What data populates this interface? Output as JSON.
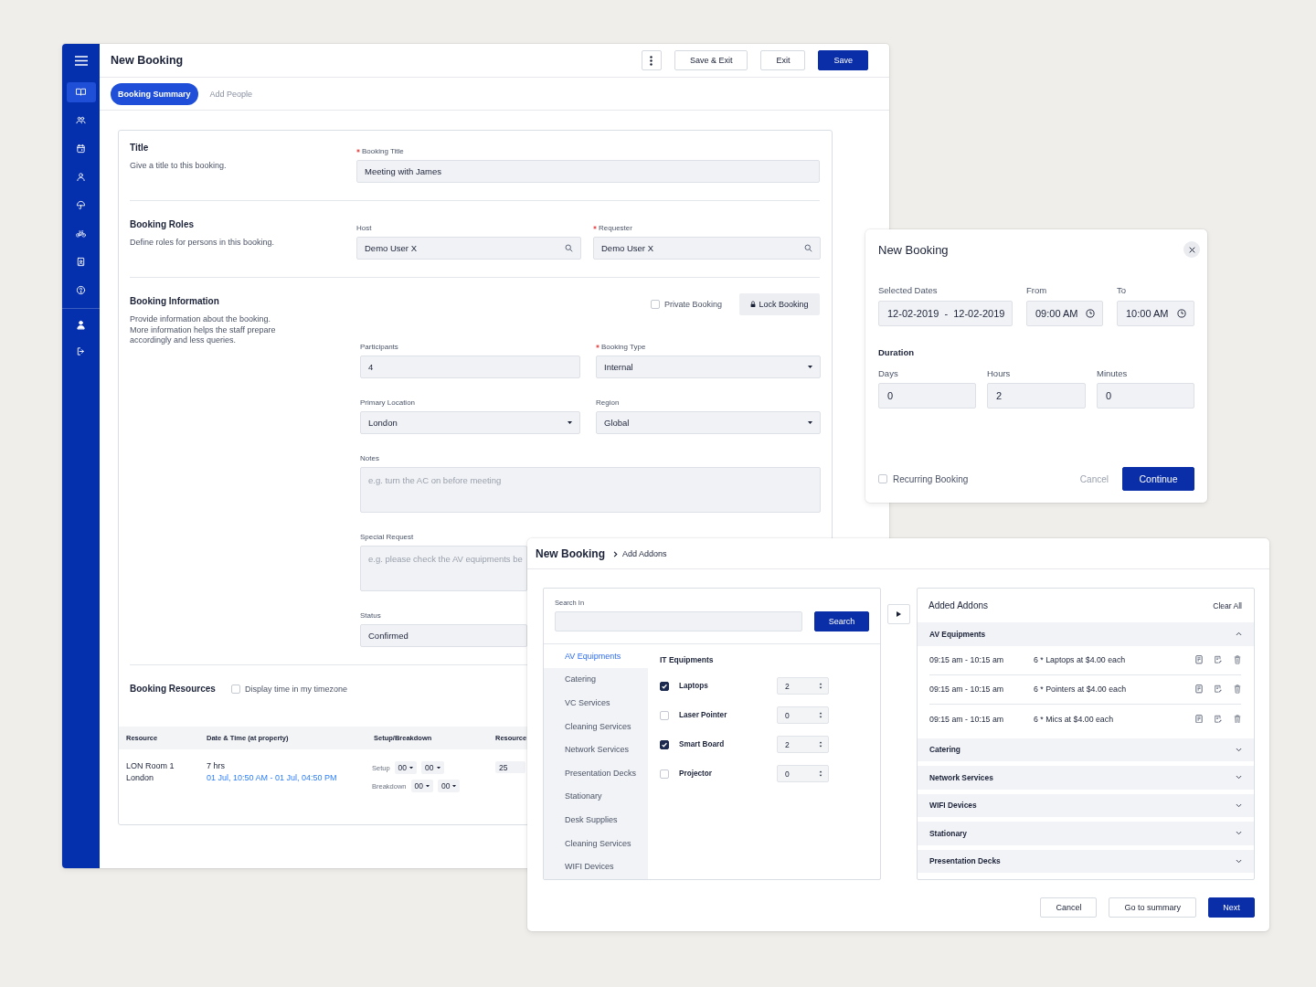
{
  "main_window": {
    "sidebar": {
      "items": [
        {
          "selected": true
        },
        {
          "selected": false
        },
        {
          "selected": false
        },
        {
          "selected": false
        },
        {
          "selected": false
        },
        {
          "selected": false
        },
        {
          "selected": false
        },
        {
          "selected": false
        }
      ],
      "bottom_items": [
        {
          "selected": false
        },
        {
          "selected": false
        }
      ]
    },
    "title": "New Booking",
    "header_buttons": [
      {
        "label": "Save & Exit",
        "kind": "outline"
      },
      {
        "label": "Exit",
        "kind": "outline"
      },
      {
        "label": "Save",
        "kind": "primary"
      }
    ],
    "tabs": [
      {
        "label": "Booking Summary",
        "selected": true
      },
      {
        "label": "Add People",
        "selected": false
      }
    ],
    "title_section": {
      "heading": "Title",
      "description": "Give a title to this booking.",
      "field": {
        "label": "Booking Title",
        "required": true,
        "value": "Meeting with James"
      }
    },
    "roles_section": {
      "heading": "Booking Roles",
      "description": "Define roles for persons in this booking.",
      "fields": [
        {
          "label": "Host",
          "required": false,
          "value": "Demo User X"
        },
        {
          "label": "Requester",
          "required": true,
          "value": "Demo User X"
        }
      ]
    },
    "information_section": {
      "heading": "Booking Information",
      "description": "Provide information about the booking.\nMore information helps the staff prepare\naccordingly and less queries.",
      "private_booking": {
        "label": "Private Booking",
        "checked": false
      },
      "lock_button": "Lock Booking",
      "fields": [
        {
          "kind": "text",
          "label": "Participants",
          "required": false,
          "value": "4"
        },
        {
          "kind": "select",
          "label": "Booking Type",
          "required": true,
          "value": "Internal"
        },
        {
          "kind": "select",
          "label": "Primary Location",
          "required": false,
          "value": "London"
        },
        {
          "kind": "select",
          "label": "Region",
          "required": false,
          "value": "Global"
        },
        {
          "kind": "textarea",
          "label": "Notes",
          "required": false,
          "placeholder": "e.g. turn the AC on before meeting"
        },
        {
          "kind": "textarea",
          "label": "Special Request",
          "required": false,
          "placeholder": "e.g. please check the AV equipments be"
        },
        {
          "kind": "text",
          "label": "Status",
          "required": false,
          "value": "Confirmed"
        }
      ]
    },
    "resources_section": {
      "heading": "Booking Resources",
      "timezone_toggle": {
        "label": "Display time in my timezone",
        "checked": false
      },
      "table": {
        "columns": [
          "Resource",
          "Date & Time (at property)",
          "Setup/Breakdown",
          "Resource"
        ],
        "rows": [
          {
            "resource": "LON Room 1",
            "location": "London",
            "duration": "7 hrs",
            "time_range": "01 Jul, 10:50 AM - 01 Jul, 04:50 PM",
            "setup": {
              "label": "Setup",
              "values": [
                "00",
                "00"
              ]
            },
            "breakdown": {
              "label": "Breakdown",
              "values": [
                "00",
                "00"
              ]
            },
            "column_4": "25"
          }
        ]
      }
    }
  },
  "duration_dialog": {
    "title": "New Booking",
    "dates": {
      "label": "Selected Dates",
      "value": "12-02-2019  -  12-02-2019"
    },
    "times": [
      {
        "label": "From",
        "value": "09:00 AM"
      },
      {
        "label": "To",
        "value": "10:00 AM"
      }
    ],
    "duration": {
      "heading": "Duration",
      "fields": [
        {
          "label": "Days",
          "value": "0"
        },
        {
          "label": "Hours",
          "value": "2"
        },
        {
          "label": "Minutes",
          "value": "0"
        }
      ]
    },
    "recurring": {
      "label": "Recurring Booking",
      "checked": false
    },
    "buttons": [
      {
        "label": "Cancel",
        "kind": "text"
      },
      {
        "label": "Continue",
        "kind": "primary"
      }
    ]
  },
  "addons_window": {
    "title": "New Booking",
    "breadcrumb": "Add Addons",
    "search": {
      "label": "Search In",
      "button": "Search"
    },
    "categories": [
      {
        "label": "AV Equipments",
        "selected": true
      },
      {
        "label": "Catering",
        "selected": false
      },
      {
        "label": "VC Services",
        "selected": false
      },
      {
        "label": "Cleaning Services",
        "selected": false
      },
      {
        "label": "Network Services",
        "selected": false
      },
      {
        "label": "Presentation Decks",
        "selected": false
      },
      {
        "label": "Stationary",
        "selected": false
      },
      {
        "label": "Desk Supplies",
        "selected": false
      },
      {
        "label": "Cleaning Services",
        "selected": false
      },
      {
        "label": "WIFI Devices",
        "selected": false
      }
    ],
    "item_group": "IT Equipments",
    "items": [
      {
        "label": "Laptops",
        "checked": true,
        "quantity": "2"
      },
      {
        "label": "Laser Pointer",
        "checked": false,
        "quantity": "0"
      },
      {
        "label": "Smart Board",
        "checked": true,
        "quantity": "2"
      },
      {
        "label": "Projector",
        "checked": false,
        "quantity": "0"
      }
    ],
    "added": {
      "title": "Added Addons",
      "clear_button": "Clear All",
      "groups": [
        {
          "label": "AV Equipments",
          "expanded": true,
          "entries": [
            {
              "time": "09:15 am - 10:15 am",
              "description": "6 * Laptops at $4.00 each"
            },
            {
              "time": "09:15 am - 10:15 am",
              "description": "6 * Pointers at $4.00 each"
            },
            {
              "time": "09:15 am - 10:15 am",
              "description": "6 * Mics at $4.00 each"
            }
          ]
        },
        {
          "label": "Catering",
          "expanded": false
        },
        {
          "label": "Network Services",
          "expanded": false
        },
        {
          "label": "WIFI Devices",
          "expanded": false
        },
        {
          "label": "Stationary",
          "expanded": false
        },
        {
          "label": "Presentation Decks",
          "expanded": false
        }
      ]
    },
    "buttons": [
      {
        "label": "Cancel",
        "kind": "outline"
      },
      {
        "label": "Go to summary",
        "kind": "outline"
      },
      {
        "label": "Next",
        "kind": "primary"
      }
    ]
  }
}
